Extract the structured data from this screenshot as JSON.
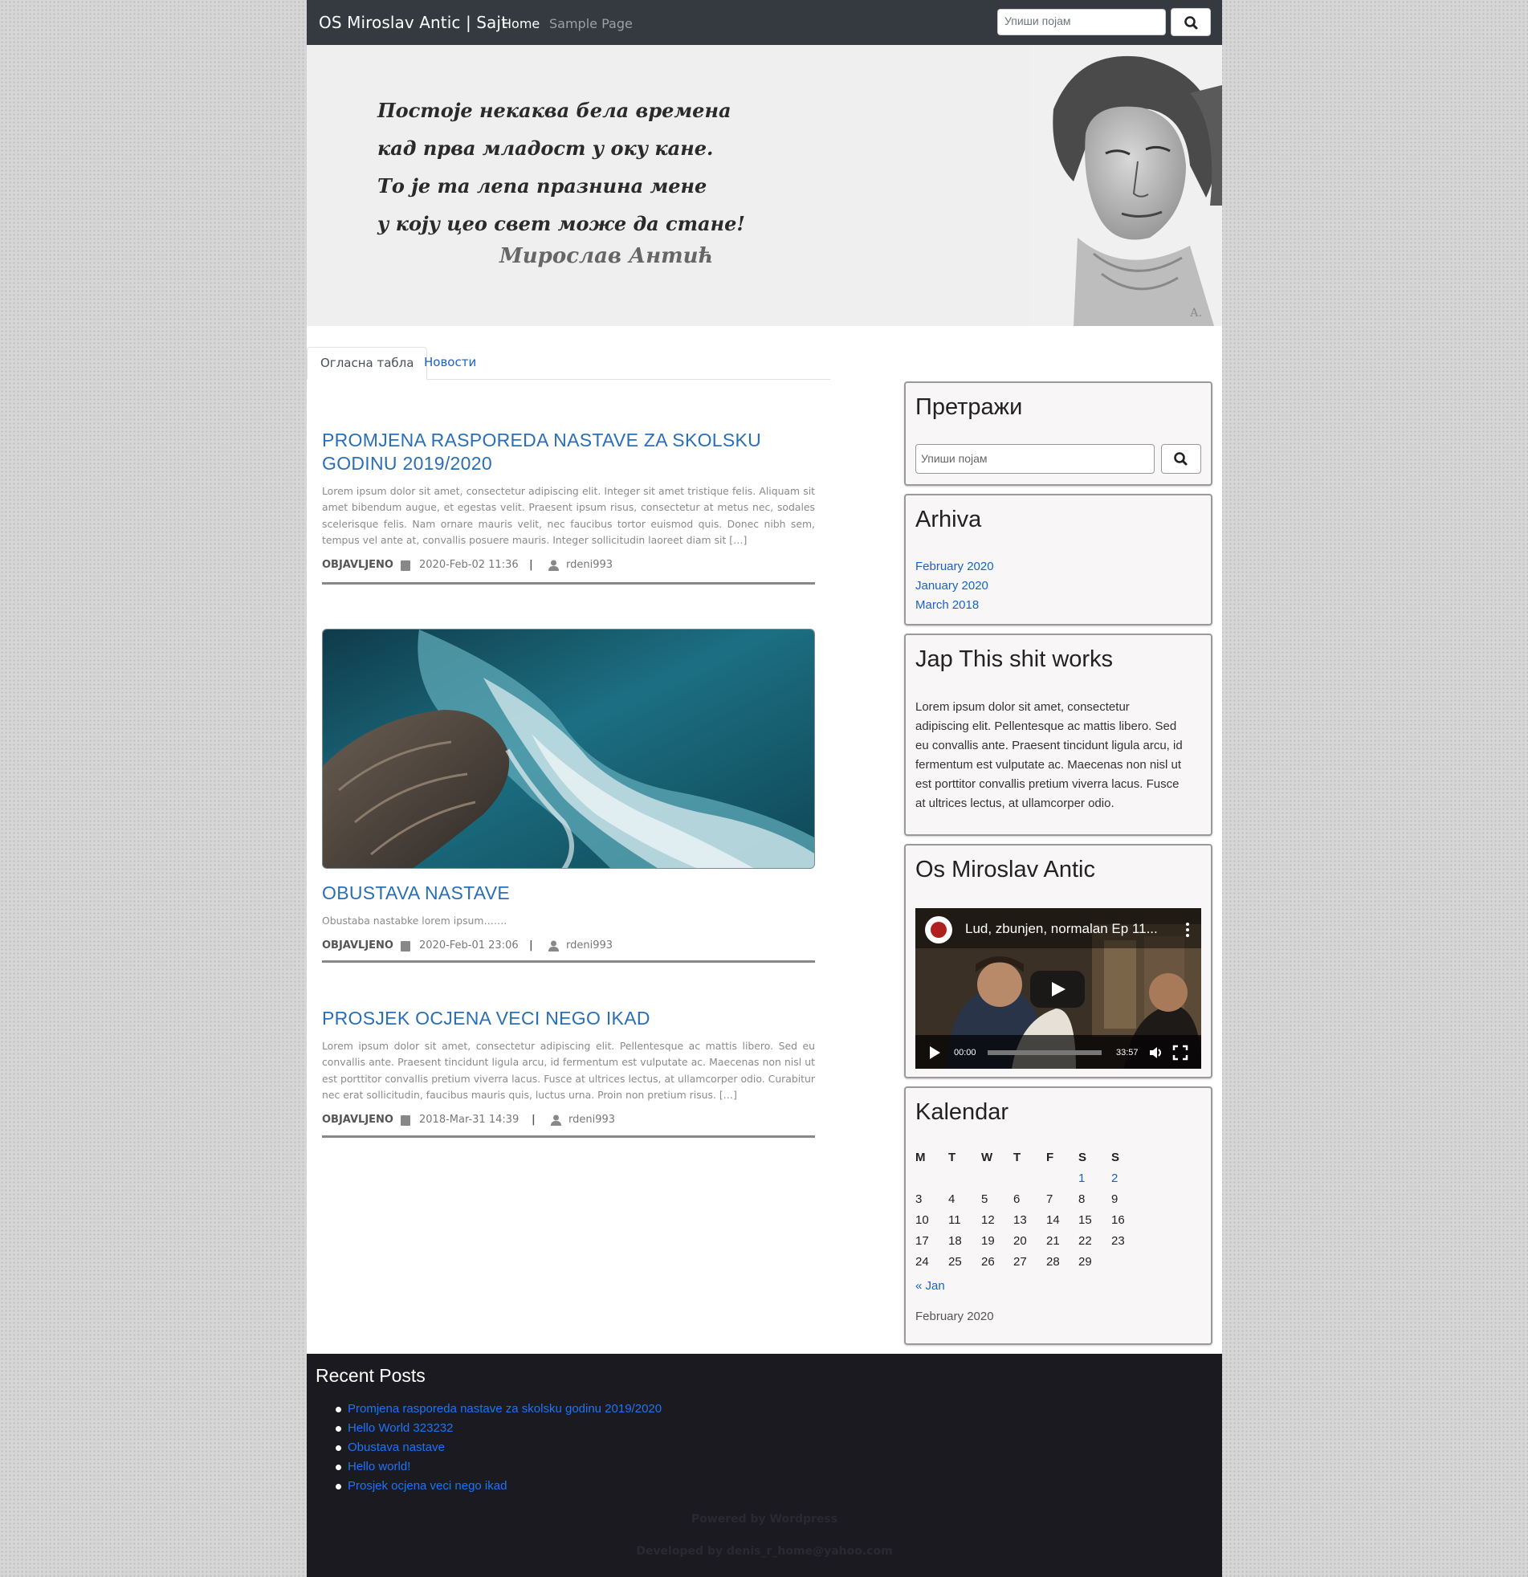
{
  "navbar": {
    "brand": "OS Miroslav Antic | Sajt",
    "links": [
      "Home",
      "Sample Page"
    ],
    "search_placeholder": "Упиши појам"
  },
  "hero": {
    "quote_lines": [
      "Постоје некаква бела времена",
      "кад прва младост у оку кане.",
      "То је та лепа празнина мене",
      "у коју цео свет може да стане!"
    ],
    "author": "Мирослав Антић",
    "portrait_signature": "А."
  },
  "tabs": [
    "Огласна табла",
    "Новости"
  ],
  "posts": [
    {
      "title": "PROMJENA RASPOREDA NASTAVE ZA SKOLSKU GODINU 2019/2020",
      "excerpt": "Lorem ipsum dolor sit amet, consectetur adipiscing elit. Integer sit amet tristique felis. Aliquam sit amet bibendum augue, et egestas velit. Praesent ipsum risus, consectetur at metus nec, sodales scelerisque felis. Nam ornare mauris velit, nec faucibus tortor euismod quis. Donec nibh sem, tempus vel ante at, convallis posuere mauris. Integer sollicitudin laoreet diam sit […]",
      "meta_label": "OBJAVLJENO",
      "date": "2020-Feb-02 11:36",
      "author": "rdeni993"
    },
    {
      "title": "OBUSTAVA NASTAVE",
      "excerpt": "Obustaba nastabke lorem ipsum…….",
      "meta_label": "OBJAVLJENO",
      "date": "2020-Feb-01 23:06",
      "author": "rdeni993"
    },
    {
      "title": "PROSJEK OCJENA VECI NEGO IKAD",
      "excerpt": "Lorem ipsum dolor sit amet, consectetur adipiscing elit. Pellentesque ac mattis libero. Sed eu convallis ante. Praesent tincidunt ligula arcu, id fermentum est vulputate ac. Maecenas non nisl ut est porttitor convallis pretium viverra lacus. Fusce at ultrices lectus, at ullamcorper odio. Curabitur nec erat sollicitudin, faucibus mauris quis, luctus urna. Proin non pretium risus. […]",
      "meta_label": "OBJAVLJENO",
      "date": "2018-Mar-31 14:39",
      "author": "rdeni993"
    }
  ],
  "sidebar": {
    "search": {
      "title": "Претражи",
      "placeholder": "Упиши појам"
    },
    "archive": {
      "title": "Arhiva",
      "links": [
        "February 2020",
        "January 2020",
        "March 2018"
      ]
    },
    "text_widget": {
      "title": "Jap This shit works",
      "lines": [
        "Lorem ipsum dolor sit amet, consectetur",
        "adipiscing elit. Pellentesque ac mattis libero. Sed",
        "eu convallis ante. Praesent tincidunt ligula arcu, id",
        "fermentum est vulputate ac. Maecenas non nisl ut",
        "est porttitor convallis pretium viverra lacus. Fusce",
        "at ultrices lectus, at ullamcorper odio."
      ]
    },
    "video": {
      "title": "Os Miroslav Antic",
      "video_title": "Lud, zbunjen, normalan Ep 11...",
      "current_time": "00:00",
      "duration": "33:57"
    },
    "calendar": {
      "title": "Kalendar",
      "weekdays": [
        "M",
        "T",
        "W",
        "T",
        "F",
        "S",
        "S"
      ],
      "weeks": [
        [
          "",
          "",
          "",
          "",
          "",
          "1",
          "2"
        ],
        [
          "3",
          "4",
          "5",
          "6",
          "7",
          "8",
          "9"
        ],
        [
          "10",
          "11",
          "12",
          "13",
          "14",
          "15",
          "16"
        ],
        [
          "17",
          "18",
          "19",
          "20",
          "21",
          "22",
          "23"
        ],
        [
          "24",
          "25",
          "26",
          "27",
          "28",
          "29",
          ""
        ]
      ],
      "linked_days": [
        "1",
        "2"
      ],
      "prev_link": "« Jan",
      "caption": "February 2020"
    }
  },
  "footer": {
    "title": "Recent Posts",
    "posts": [
      "Promjena rasporeda nastave za skolsku godinu 2019/2020",
      "Hello World 323232",
      "Obustava nastave",
      "Hello world!",
      "Prosjek ocjena veci nego ikad"
    ],
    "powered": "Powered by Wordpress",
    "developed": "Developed by denis_r_home@yahoo.com"
  },
  "icons": [
    "search-icon",
    "calendar-icon",
    "user-icon",
    "play-icon",
    "volume-icon",
    "fullscreen-icon",
    "more-icon"
  ],
  "colors": {
    "navbar": "#343a40",
    "link": "#1a62c4",
    "footer": "#1b1a21",
    "post_title": "#2a6fb5"
  }
}
